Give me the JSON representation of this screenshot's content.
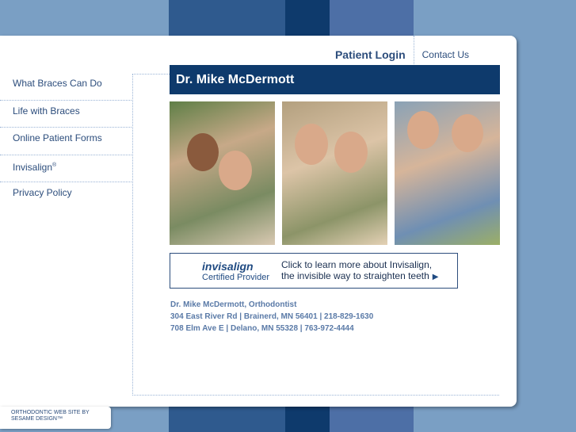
{
  "colors": {
    "bg": "#7a9fc4",
    "navy": "#0e3a6c",
    "accent": "#2c4d7c"
  },
  "topnav": {
    "patient_login": "Patient Login",
    "contact": "Contact Us"
  },
  "sidebar": {
    "items": [
      {
        "label": "What Braces Can Do"
      },
      {
        "label": "Life with Braces"
      },
      {
        "label": "Online Patient Forms"
      },
      {
        "label": "Invisalign",
        "mark": "®"
      },
      {
        "label": "Privacy Policy"
      }
    ]
  },
  "main": {
    "title": "Dr. Mike McDermott"
  },
  "banner": {
    "brand": "invisalign",
    "brand_sub": "Certified Provider",
    "line1": "Click to learn more about Invisalign,",
    "line2": "the invisible way to straighten teeth"
  },
  "address": {
    "line1": "Dr. Mike McDermott, Orthodontist",
    "line2": "304 East River Rd | Brainerd, MN 56401 | 218-829-1630",
    "line3": "708 Elm Ave E | Delano, MN 55328 | 763-972-4444"
  },
  "footer": {
    "line1": "ORTHODONTIC WEB SITE BY",
    "line2": "SESAME DESIGN™"
  }
}
